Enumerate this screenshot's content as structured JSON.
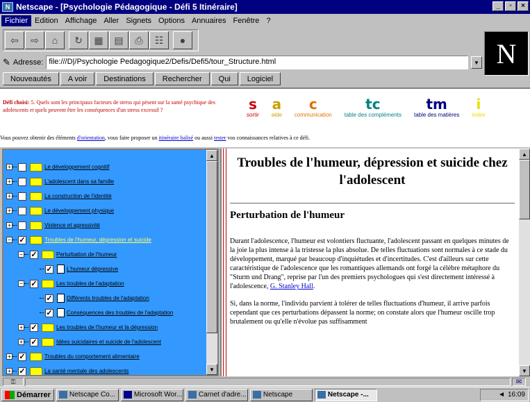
{
  "window": {
    "title": "Netscape - [Psychologie Pédagogique - Défi 5 Itinéraire]",
    "buttons": [
      "_",
      "▫",
      "×"
    ]
  },
  "menu": [
    "Fichier",
    "Edition",
    "Affichage",
    "Aller",
    "Signets",
    "Options",
    "Annuaires",
    "Fenêtre",
    "?"
  ],
  "toolbar": {
    "icons": [
      "back-icon",
      "forward-icon",
      "home-icon",
      "reload-icon",
      "images-icon",
      "open-icon",
      "print-icon",
      "find-icon",
      "stop-icon"
    ]
  },
  "location": {
    "label": "Adresse:",
    "value": "file:///D|/Psychologie Pedagogique2/Defis/Defi5/tour_Structure.html"
  },
  "directory_buttons": [
    "Nouveautés",
    "A voir",
    "Destinations",
    "Rechercher",
    "Qui",
    "Logiciel"
  ],
  "logo": "N",
  "header": {
    "defi_label": "Défi choisi:",
    "defi_text": "5. Quels sont les principaux facteurs de stress qui pèsent sur la santé psychique des adolescents et quels peuvent être les conséquences d'un stress excessif ?",
    "nav": [
      {
        "letter": "s",
        "label": "sortir",
        "color": "#cc0000"
      },
      {
        "letter": "a",
        "label": "aide",
        "color": "#c8a000"
      },
      {
        "letter": "c",
        "label": "communication",
        "color": "#e07000"
      },
      {
        "letter": "tc",
        "label": "table des compléments",
        "color": "#008080"
      },
      {
        "letter": "tm",
        "label": "table des matières",
        "color": "#000080"
      },
      {
        "letter": "i",
        "label": "index",
        "color": "#e8e000"
      }
    ],
    "intro_before": "Vous pouvez obtenir des éléments ",
    "intro_link1": "d'orientation",
    "intro_middle1": ", vous faire proposer un ",
    "intro_link2": "itinéraire balisé",
    "intro_middle2": " ou aussi ",
    "intro_link3": "tester",
    "intro_after": " vos connaissances relatives à ce défi."
  },
  "tree": [
    {
      "label": "Le développement cognitif",
      "checked": false,
      "kind": "folder",
      "level": 0
    },
    {
      "label": "L'adolescent dans sa famille",
      "checked": false,
      "kind": "folder",
      "level": 0
    },
    {
      "label": "La construction de l'identité",
      "checked": false,
      "kind": "folder",
      "level": 0
    },
    {
      "label": "Le développement physique",
      "checked": false,
      "kind": "folder",
      "level": 0
    },
    {
      "label": "Violence et agressivité",
      "checked": false,
      "kind": "folder",
      "level": 0
    },
    {
      "label": "Troubles de l'humeur, dépression et suicide",
      "checked": true,
      "kind": "folder",
      "level": 0
    },
    {
      "label": "Perturbation de l'humeur",
      "checked": true,
      "kind": "folder",
      "level": 1
    },
    {
      "label": "L'humeur dépressive",
      "checked": true,
      "kind": "doc",
      "level": 2
    },
    {
      "label": "Les troubles de l'adaptation",
      "checked": true,
      "kind": "folder",
      "level": 1
    },
    {
      "label": "Différents troubles de l'adaptation",
      "checked": true,
      "kind": "doc",
      "level": 2
    },
    {
      "label": "Conséquences des troubles de l'adaptation",
      "checked": true,
      "kind": "doc",
      "level": 2
    },
    {
      "label": "Les troubles de l'humeur et la dépression",
      "checked": true,
      "kind": "folder",
      "level": 1
    },
    {
      "label": "Idées suicidaires et suicide de l'adolescent",
      "checked": true,
      "kind": "folder",
      "level": 1
    },
    {
      "label": "Troubles du comportement alimentaire",
      "checked": true,
      "kind": "folder",
      "level": 0
    },
    {
      "label": "La santé mentale des adolescents",
      "checked": true,
      "kind": "folder",
      "level": 0
    }
  ],
  "content": {
    "title": "Troubles de l'humeur, dépression et suicide chez l'adolescent",
    "section": "Perturbation de l'humeur",
    "p1": "Durant l'adolescence, l'humeur est volontiers fluctuante, l'adolescent passant en quelques minutes de la joie la plus intense à la tristesse la plus absolue. De telles fluctuations sont normales à ce stade du développement, marqué par beaucoup d'inquiétudes et d'incertitudes. C'est d'ailleurs sur cette caractéristique de l'adolescence que les romantiques allemands ont forgé la célèbre métaphore du \"Sturm und Drang\", reprise par l'un des premiers psychologues qui s'est directement intéressé à l'adolescence, ",
    "p1_link": "G. Stanley Hall",
    "p1_end": ".",
    "p2": "Si, dans la norme, l'individu parvient à tolérer de telles fluctuations d'humeur, il arrive parfois cependant que ces perturbations dépassent la norme; on constate alors que l'humeur oscille trop brutalement ou qu'elle n'évolue pas suffisamment"
  },
  "taskbar": {
    "start": "Démarrer",
    "tasks": [
      "Netscape Co...",
      "Microsoft Wor...",
      "Carnet d'adre...",
      "Netscape",
      "Netscape -..."
    ],
    "active_index": 4,
    "clock": "16:09"
  }
}
